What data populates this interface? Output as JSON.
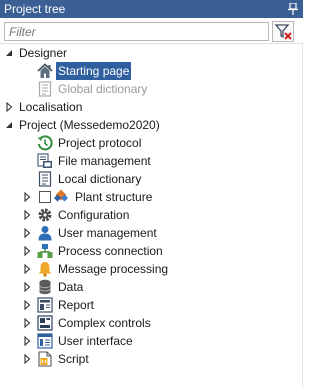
{
  "panel": {
    "title": "Project tree"
  },
  "filter": {
    "placeholder": "Filter"
  },
  "tree": {
    "designer": {
      "label": "Designer",
      "starting_page": "Starting page",
      "global_dictionary": "Global dictionary"
    },
    "localisation": {
      "label": "Localisation"
    },
    "project": {
      "label": "Project (Messedemo2020)",
      "items": {
        "project_protocol": "Project protocol",
        "file_management": "File management",
        "local_dictionary": "Local dictionary",
        "plant_structure": "Plant structure",
        "configuration": "Configuration",
        "user_management": "User management",
        "process_connection": "Process connection",
        "message_processing": "Message processing",
        "data": "Data",
        "report": "Report",
        "complex_controls": "Complex controls",
        "user_interface": "User interface",
        "script": "Script"
      }
    }
  },
  "colors": {
    "title_bar": "#3a5f95",
    "selection": "#2f5f9e"
  }
}
